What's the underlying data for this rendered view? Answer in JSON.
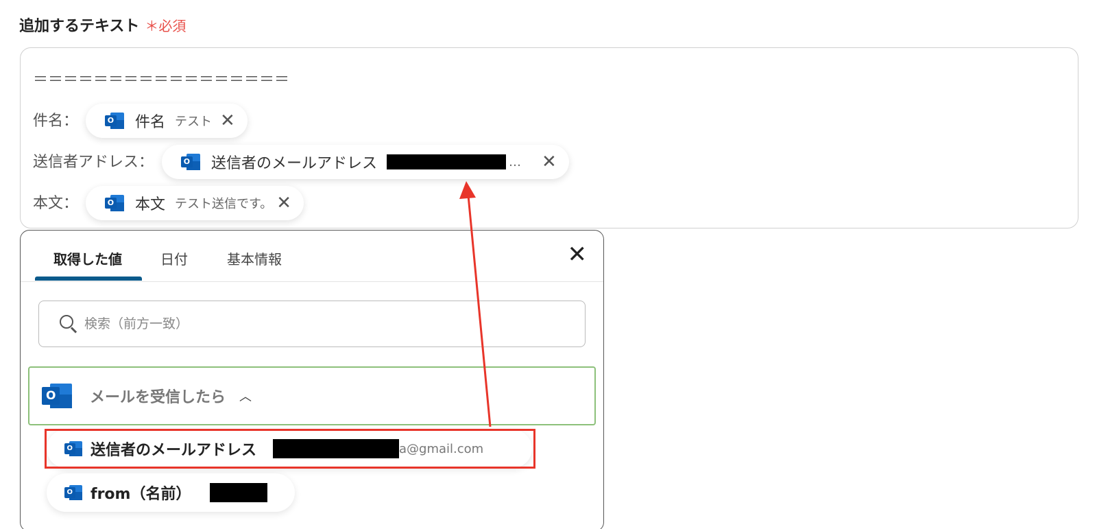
{
  "field": {
    "label": "追加するテキスト",
    "required_mark": "＊必須"
  },
  "editor": {
    "separator": "＝＝＝＝＝＝＝＝＝＝＝＝＝＝＝＝＝",
    "lines": [
      {
        "label": "件名：",
        "chip_name": "件名",
        "chip_value": "テスト"
      },
      {
        "label": "送信者アドレス：",
        "chip_name": "送信者のメールアドレス",
        "chip_value": "…"
      },
      {
        "label": "本文：",
        "chip_name": "本文",
        "chip_value": "テスト送信です。"
      }
    ]
  },
  "panel": {
    "tabs": [
      {
        "label": "取得した値",
        "active": true
      },
      {
        "label": "日付",
        "active": false
      },
      {
        "label": "基本情報",
        "active": false
      }
    ],
    "search_placeholder": "検索（前方一致）",
    "group_label": "メールを受信したら",
    "items": [
      {
        "name": "送信者のメールアドレス",
        "value": "a@gmail.com",
        "highlighted": true
      },
      {
        "name": "from（名前）",
        "value": ""
      }
    ]
  },
  "icons": {
    "outlook": "outlook-icon",
    "remove": "close-icon",
    "search": "search-icon",
    "collapse": "chevron-up-icon"
  },
  "colors": {
    "required": "#e8504a",
    "tab_underline": "#0c5a8c",
    "group_border": "#8cc07a",
    "highlight": "#e8352a",
    "outlook_blue": "#0a5bb0"
  }
}
